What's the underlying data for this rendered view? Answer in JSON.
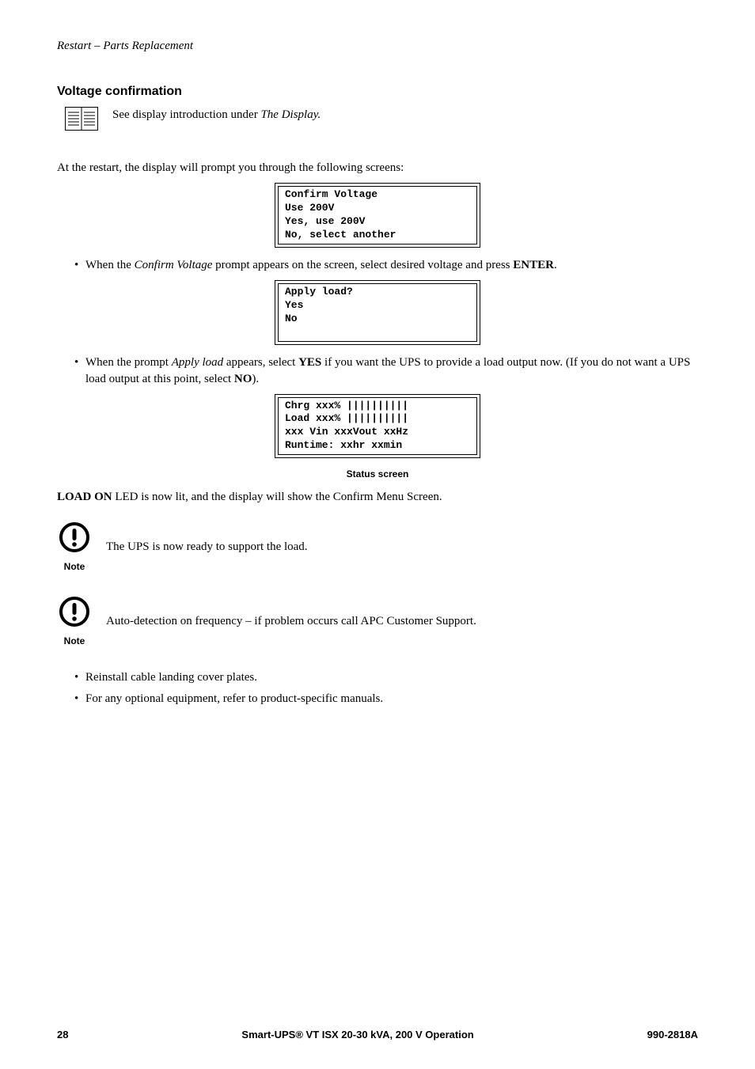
{
  "running_header": "Restart – Parts Replacement",
  "section_heading": "Voltage confirmation",
  "intro_prefix": "See display introduction under ",
  "intro_italic": "The Display.",
  "restart_prompt": "At the restart, the display will prompt you through the following screens:",
  "lcd1": {
    "l1": "Confirm Voltage",
    "l2": "Use 200V",
    "l3": "Yes, use 200V",
    "l4": "No, select another"
  },
  "bullet1_prefix": "When the ",
  "bullet1_italic": "Confirm Voltage",
  "bullet1_mid": " prompt appears on the screen, select desired voltage and press ",
  "bullet1_bold": "ENTER",
  "bullet1_suffix": ".",
  "lcd2": {
    "l1": "Apply load?",
    "l2": "Yes",
    "l3": "No",
    "l4": " "
  },
  "bullet2_prefix": "When the prompt ",
  "bullet2_italic": "Apply load",
  "bullet2_mid1": " appears, select ",
  "bullet2_bold1": "YES",
  "bullet2_mid2": " if you want the UPS to provide a load output now. (If you do not want a UPS load output at this point, select ",
  "bullet2_bold2": "NO",
  "bullet2_suffix": ").",
  "lcd3": {
    "l1": "Chrg xxx% ||||||||||",
    "l2": "Load xxx% ||||||||||",
    "l3": "xxx Vin xxxVout xxHz",
    "l4": "Runtime: xxhr xxmin"
  },
  "status_caption": "Status screen",
  "load_on_bold": "LOAD ON",
  "load_on_rest": " LED is now lit, and the display will show the Confirm Menu Screen.",
  "note1": "The UPS is now ready to support the load.",
  "note2": "Auto-detection on frequency – if problem occurs call APC Customer Support.",
  "note_label": "Note",
  "bullet3": "Reinstall cable landing cover plates.",
  "bullet4": "For any optional equipment, refer to product-specific manuals.",
  "footer_page": "28",
  "footer_center": "Smart-UPS® VT ISX 20-30 kVA, 200 V Operation",
  "footer_right": "990-2818A"
}
